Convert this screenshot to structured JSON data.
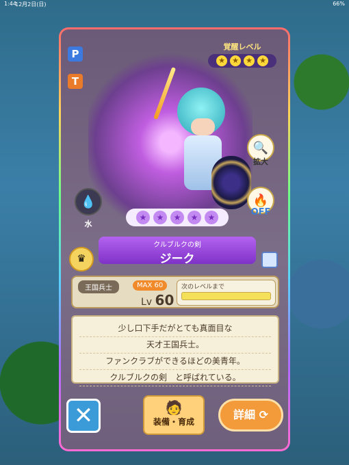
{
  "status_bar": {
    "time": "1:44",
    "date": "12月2日(日)",
    "battery": "66%"
  },
  "tabs": [
    "P",
    "T"
  ],
  "awake": {
    "label": "覚醒レベル",
    "stars": 4
  },
  "element": {
    "label": "水"
  },
  "buttons": {
    "zoom": "拡大",
    "toggle": "OFF",
    "equip": "装備・育成",
    "detail": "詳細",
    "close": "✕"
  },
  "rarity": {
    "stars": 5
  },
  "character": {
    "title": "クルブルクの剣",
    "name": "ジーク"
  },
  "stats": {
    "job": "王国兵士",
    "max": "MAX 60",
    "level_prefix": "Lv",
    "level": "60",
    "next_label": "次のレベルまで"
  },
  "description": [
    "少し口下手だがとても真面目な",
    "天才王国兵士。",
    "ファンクラブができるほどの美青年。",
    "クルブルクの剣　と呼ばれている。"
  ]
}
